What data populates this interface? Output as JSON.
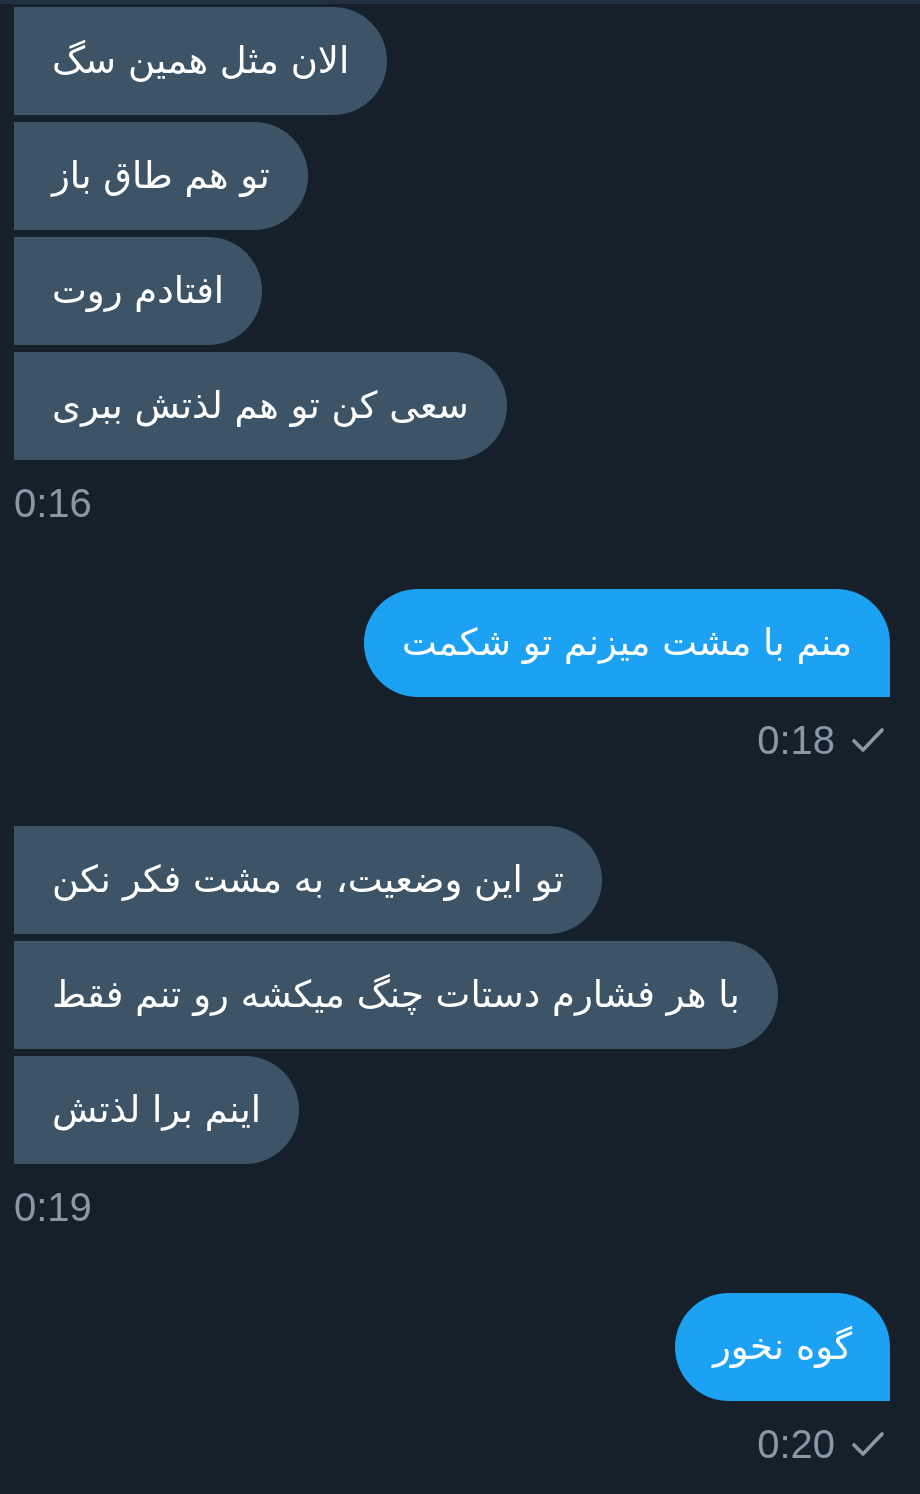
{
  "conversation": [
    {
      "kind": "received",
      "messages": [
        {
          "text": "الان مثل همین سگ"
        },
        {
          "text": "تو هم طاق باز"
        },
        {
          "text": "افتادم روت"
        },
        {
          "text": "سعی کن تو هم لذتش ببری"
        }
      ],
      "time": "0:16"
    },
    {
      "kind": "sent",
      "messages": [
        {
          "text": "منم با مشت میزنم تو شکمت"
        }
      ],
      "time": "0:18",
      "delivered": true
    },
    {
      "kind": "received",
      "messages": [
        {
          "text": "تو این وضعیت، به مشت فکر نکن"
        },
        {
          "text": "با هر فشارم دستات چنگ میکشه رو تنم فقط"
        },
        {
          "text": "اینم برا لذتش"
        }
      ],
      "time": "0:19"
    },
    {
      "kind": "sent",
      "messages": [
        {
          "text": "گوه نخور"
        }
      ],
      "time": "0:20",
      "delivered": true
    }
  ]
}
